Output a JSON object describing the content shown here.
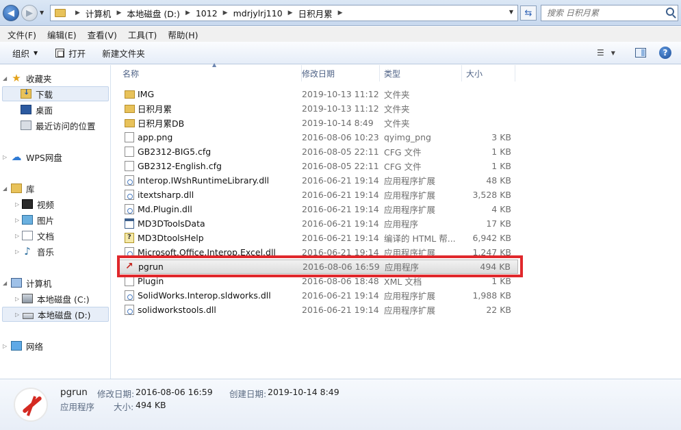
{
  "address": {
    "crumbs": [
      "计算机",
      "本地磁盘 (D:)",
      "1012",
      "mdrjylrj110",
      "日积月累"
    ],
    "search_placeholder": "搜索 日积月累"
  },
  "menu": [
    "文件(F)",
    "编辑(E)",
    "查看(V)",
    "工具(T)",
    "帮助(H)"
  ],
  "commands": {
    "organize": "组织",
    "open": "打开",
    "new_folder": "新建文件夹"
  },
  "sidebar": {
    "favorites": "收藏夹",
    "downloads": "下载",
    "desktop": "桌面",
    "recent": "最近访问的位置",
    "wps": "WPS网盘",
    "libraries": "库",
    "videos": "视频",
    "pictures": "图片",
    "documents": "文档",
    "music": "音乐",
    "computer": "计算机",
    "drive_c": "本地磁盘 (C:)",
    "drive_d": "本地磁盘 (D:)",
    "network": "网络"
  },
  "columns": {
    "name": "名称",
    "date": "修改日期",
    "type": "类型",
    "size": "大小"
  },
  "files": [
    {
      "name": "IMG",
      "date": "2019-10-13 11:12",
      "type": "文件夹",
      "size": "",
      "icon": "folder"
    },
    {
      "name": "日积月累",
      "date": "2019-10-13 11:12",
      "type": "文件夹",
      "size": "",
      "icon": "folder"
    },
    {
      "name": "日积月累DB",
      "date": "2019-10-14 8:49",
      "type": "文件夹",
      "size": "",
      "icon": "folder"
    },
    {
      "name": "app.png",
      "date": "2016-08-06 10:23",
      "type": "qyimg_png",
      "size": "3 KB",
      "icon": "file"
    },
    {
      "name": "GB2312-BIG5.cfg",
      "date": "2016-08-05 22:11",
      "type": "CFG 文件",
      "size": "1 KB",
      "icon": "file"
    },
    {
      "name": "GB2312-English.cfg",
      "date": "2016-08-05 22:11",
      "type": "CFG 文件",
      "size": "1 KB",
      "icon": "file"
    },
    {
      "name": "Interop.IWshRuntimeLibrary.dll",
      "date": "2016-06-21 19:14",
      "type": "应用程序扩展",
      "size": "48 KB",
      "icon": "dll"
    },
    {
      "name": "itextsharp.dll",
      "date": "2016-06-21 19:14",
      "type": "应用程序扩展",
      "size": "3,528 KB",
      "icon": "dll"
    },
    {
      "name": "Md.Plugin.dll",
      "date": "2016-06-21 19:14",
      "type": "应用程序扩展",
      "size": "4 KB",
      "icon": "dll"
    },
    {
      "name": "MD3DToolsData",
      "date": "2016-06-21 19:14",
      "type": "应用程序",
      "size": "17 KB",
      "icon": "app"
    },
    {
      "name": "MD3DtoolsHelp",
      "date": "2016-06-21 19:14",
      "type": "编译的 HTML 帮...",
      "size": "6,942 KB",
      "icon": "help"
    },
    {
      "name": "Microsoft.Office.Interop.Excel.dll",
      "date": "2016-06-21 19:14",
      "type": "应用程序扩展",
      "size": "1,247 KB",
      "icon": "dll"
    },
    {
      "name": "pgrun",
      "date": "2016-08-06 16:59",
      "type": "应用程序",
      "size": "494 KB",
      "icon": "pg"
    },
    {
      "name": "Plugin",
      "date": "2016-08-06 18:48",
      "type": "XML 文档",
      "size": "1 KB",
      "icon": "file"
    },
    {
      "name": "SolidWorks.Interop.sldworks.dll",
      "date": "2016-06-21 19:14",
      "type": "应用程序扩展",
      "size": "1,988 KB",
      "icon": "dll"
    },
    {
      "name": "solidworkstools.dll",
      "date": "2016-06-21 19:14",
      "type": "应用程序扩展",
      "size": "22 KB",
      "icon": "dll"
    }
  ],
  "details": {
    "name": "pgrun",
    "type": "应用程序",
    "modified_label": "修改日期:",
    "modified_value": "2016-08-06 16:59",
    "created_label": "创建日期:",
    "created_value": "2019-10-14 8:49",
    "size_label": "大小:",
    "size_value": "494 KB"
  }
}
